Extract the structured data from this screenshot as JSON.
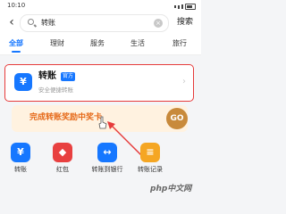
{
  "status": {
    "time": "10:10"
  },
  "search": {
    "query": "转账",
    "button_label": "搜索"
  },
  "tabs": [
    {
      "label": "全部"
    },
    {
      "label": "理财"
    },
    {
      "label": "服务"
    },
    {
      "label": "生活"
    },
    {
      "label": "旅行"
    }
  ],
  "result": {
    "title": "转账",
    "badge": "官方",
    "description": "安全便捷转账"
  },
  "promo": {
    "text": "完成转账奖励中奖卡",
    "go_label": "GO"
  },
  "services": [
    {
      "label": "转账",
      "icon": "¥",
      "color": "#1677ff"
    },
    {
      "label": "红包",
      "icon": "◆",
      "color": "#e84040"
    },
    {
      "label": "转账到银行",
      "icon": "↔",
      "color": "#1677ff"
    },
    {
      "label": "转账记录",
      "icon": "≡",
      "color": "#f5a623"
    }
  ],
  "watermark": "php中文网",
  "colors": {
    "accent": "#1677ff",
    "highlight": "#e63b3b",
    "promo": "#e66a1a"
  }
}
